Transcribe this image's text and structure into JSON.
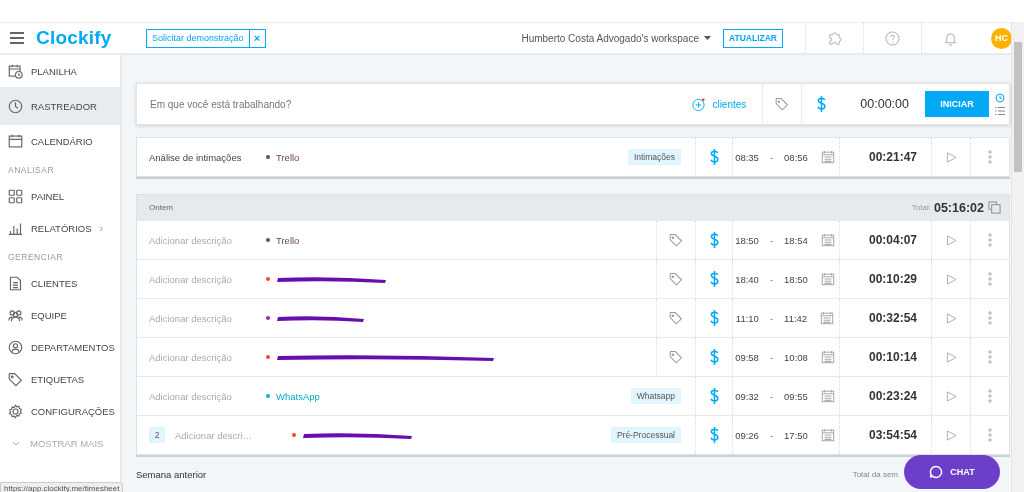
{
  "header": {
    "logo": "Clockify",
    "demo_button": "Solicitar demonstração",
    "demo_close": "×",
    "workspace": "Humberto Costa Advogado's workspace",
    "upgrade_button": "ATUALIZAR",
    "avatar": "HC"
  },
  "sidebar": {
    "items": [
      {
        "kind": "item",
        "label": "PLANILHA",
        "selected": false
      },
      {
        "kind": "item",
        "label": "RASTREADOR",
        "selected": true
      },
      {
        "kind": "item",
        "label": "CALENDÁRIO",
        "selected": false
      },
      {
        "kind": "section",
        "label": "ANALISAR"
      },
      {
        "kind": "item",
        "label": "PAINEL",
        "selected": false
      },
      {
        "kind": "item",
        "label": "RELATÓRIOS",
        "selected": false,
        "chevron": "›"
      },
      {
        "kind": "section",
        "label": "GERENCIAR"
      },
      {
        "kind": "item",
        "label": "CLIENTES",
        "selected": false
      },
      {
        "kind": "item",
        "label": "EQUIPE",
        "selected": false
      },
      {
        "kind": "item",
        "label": "DEPARTAMENTOS",
        "selected": false
      },
      {
        "kind": "item",
        "label": "ETIQUETAS",
        "selected": false
      },
      {
        "kind": "item",
        "label": "CONFIGURAÇÕES",
        "selected": false
      },
      {
        "kind": "more",
        "label": "MOSTRAR MAIS"
      }
    ],
    "status_url": "https://app.clockify.me/timesheet"
  },
  "timer": {
    "placeholder": "Em que você está trabalhando?",
    "project_button": "clientes",
    "time": "00:00:00",
    "start_button": "INICIAR"
  },
  "groups": [
    {
      "rows": [
        {
          "description": "Análise de intimações",
          "placeholder": false,
          "project": {
            "name": "Trello",
            "color": "#6d4c41",
            "redacted": false
          },
          "tag": "Intimações",
          "start": "08:35",
          "separator": "-",
          "end": "08:56",
          "duration": "00:21:47"
        }
      ]
    },
    {
      "title": "Ontem",
      "total_label": "Total:",
      "total": "05:16:02",
      "rows": [
        {
          "description": "Adicionar descrição",
          "placeholder": true,
          "project": {
            "name": "Trello",
            "color": "#6d4c41",
            "redacted": false
          },
          "start": "18:50",
          "separator": "-",
          "end": "18:54",
          "duration": "00:04:07"
        },
        {
          "description": "Adicionar descrição",
          "placeholder": true,
          "project": {
            "color": "#f44336",
            "redacted": true
          },
          "start": "18:40",
          "separator": "-",
          "end": "18:50",
          "duration": "00:10:29"
        },
        {
          "description": "Adicionar descrição",
          "placeholder": true,
          "project": {
            "color": "#9c27b0",
            "redacted": true
          },
          "start": "11:10",
          "separator": "-",
          "end": "11:42",
          "duration": "00:32:54"
        },
        {
          "description": "Adicionar descrição",
          "placeholder": true,
          "project": {
            "color": "#f44336",
            "redacted": true
          },
          "start": "09:58",
          "separator": "-",
          "end": "10:08",
          "duration": "00:10:14"
        },
        {
          "description": "Adicionar descrição",
          "placeholder": true,
          "project": {
            "name": "WhatsApp",
            "color": "#00bcd4",
            "redacted": false
          },
          "tag": "Whatsapp",
          "start": "09:32",
          "separator": "-",
          "end": "09:55",
          "duration": "00:23:24"
        },
        {
          "count": "2",
          "description": "Adicionar descri…",
          "placeholder": true,
          "project": {
            "color": "#f44336",
            "redacted": true
          },
          "tag": "Pré-Processual",
          "start": "09:26",
          "separator": "-",
          "end": "17:50",
          "duration": "03:54:54"
        }
      ]
    }
  ],
  "previous_week": {
    "title": "Semana anterior",
    "total_label": "Total da sem"
  },
  "chat_button": "CHAT"
}
